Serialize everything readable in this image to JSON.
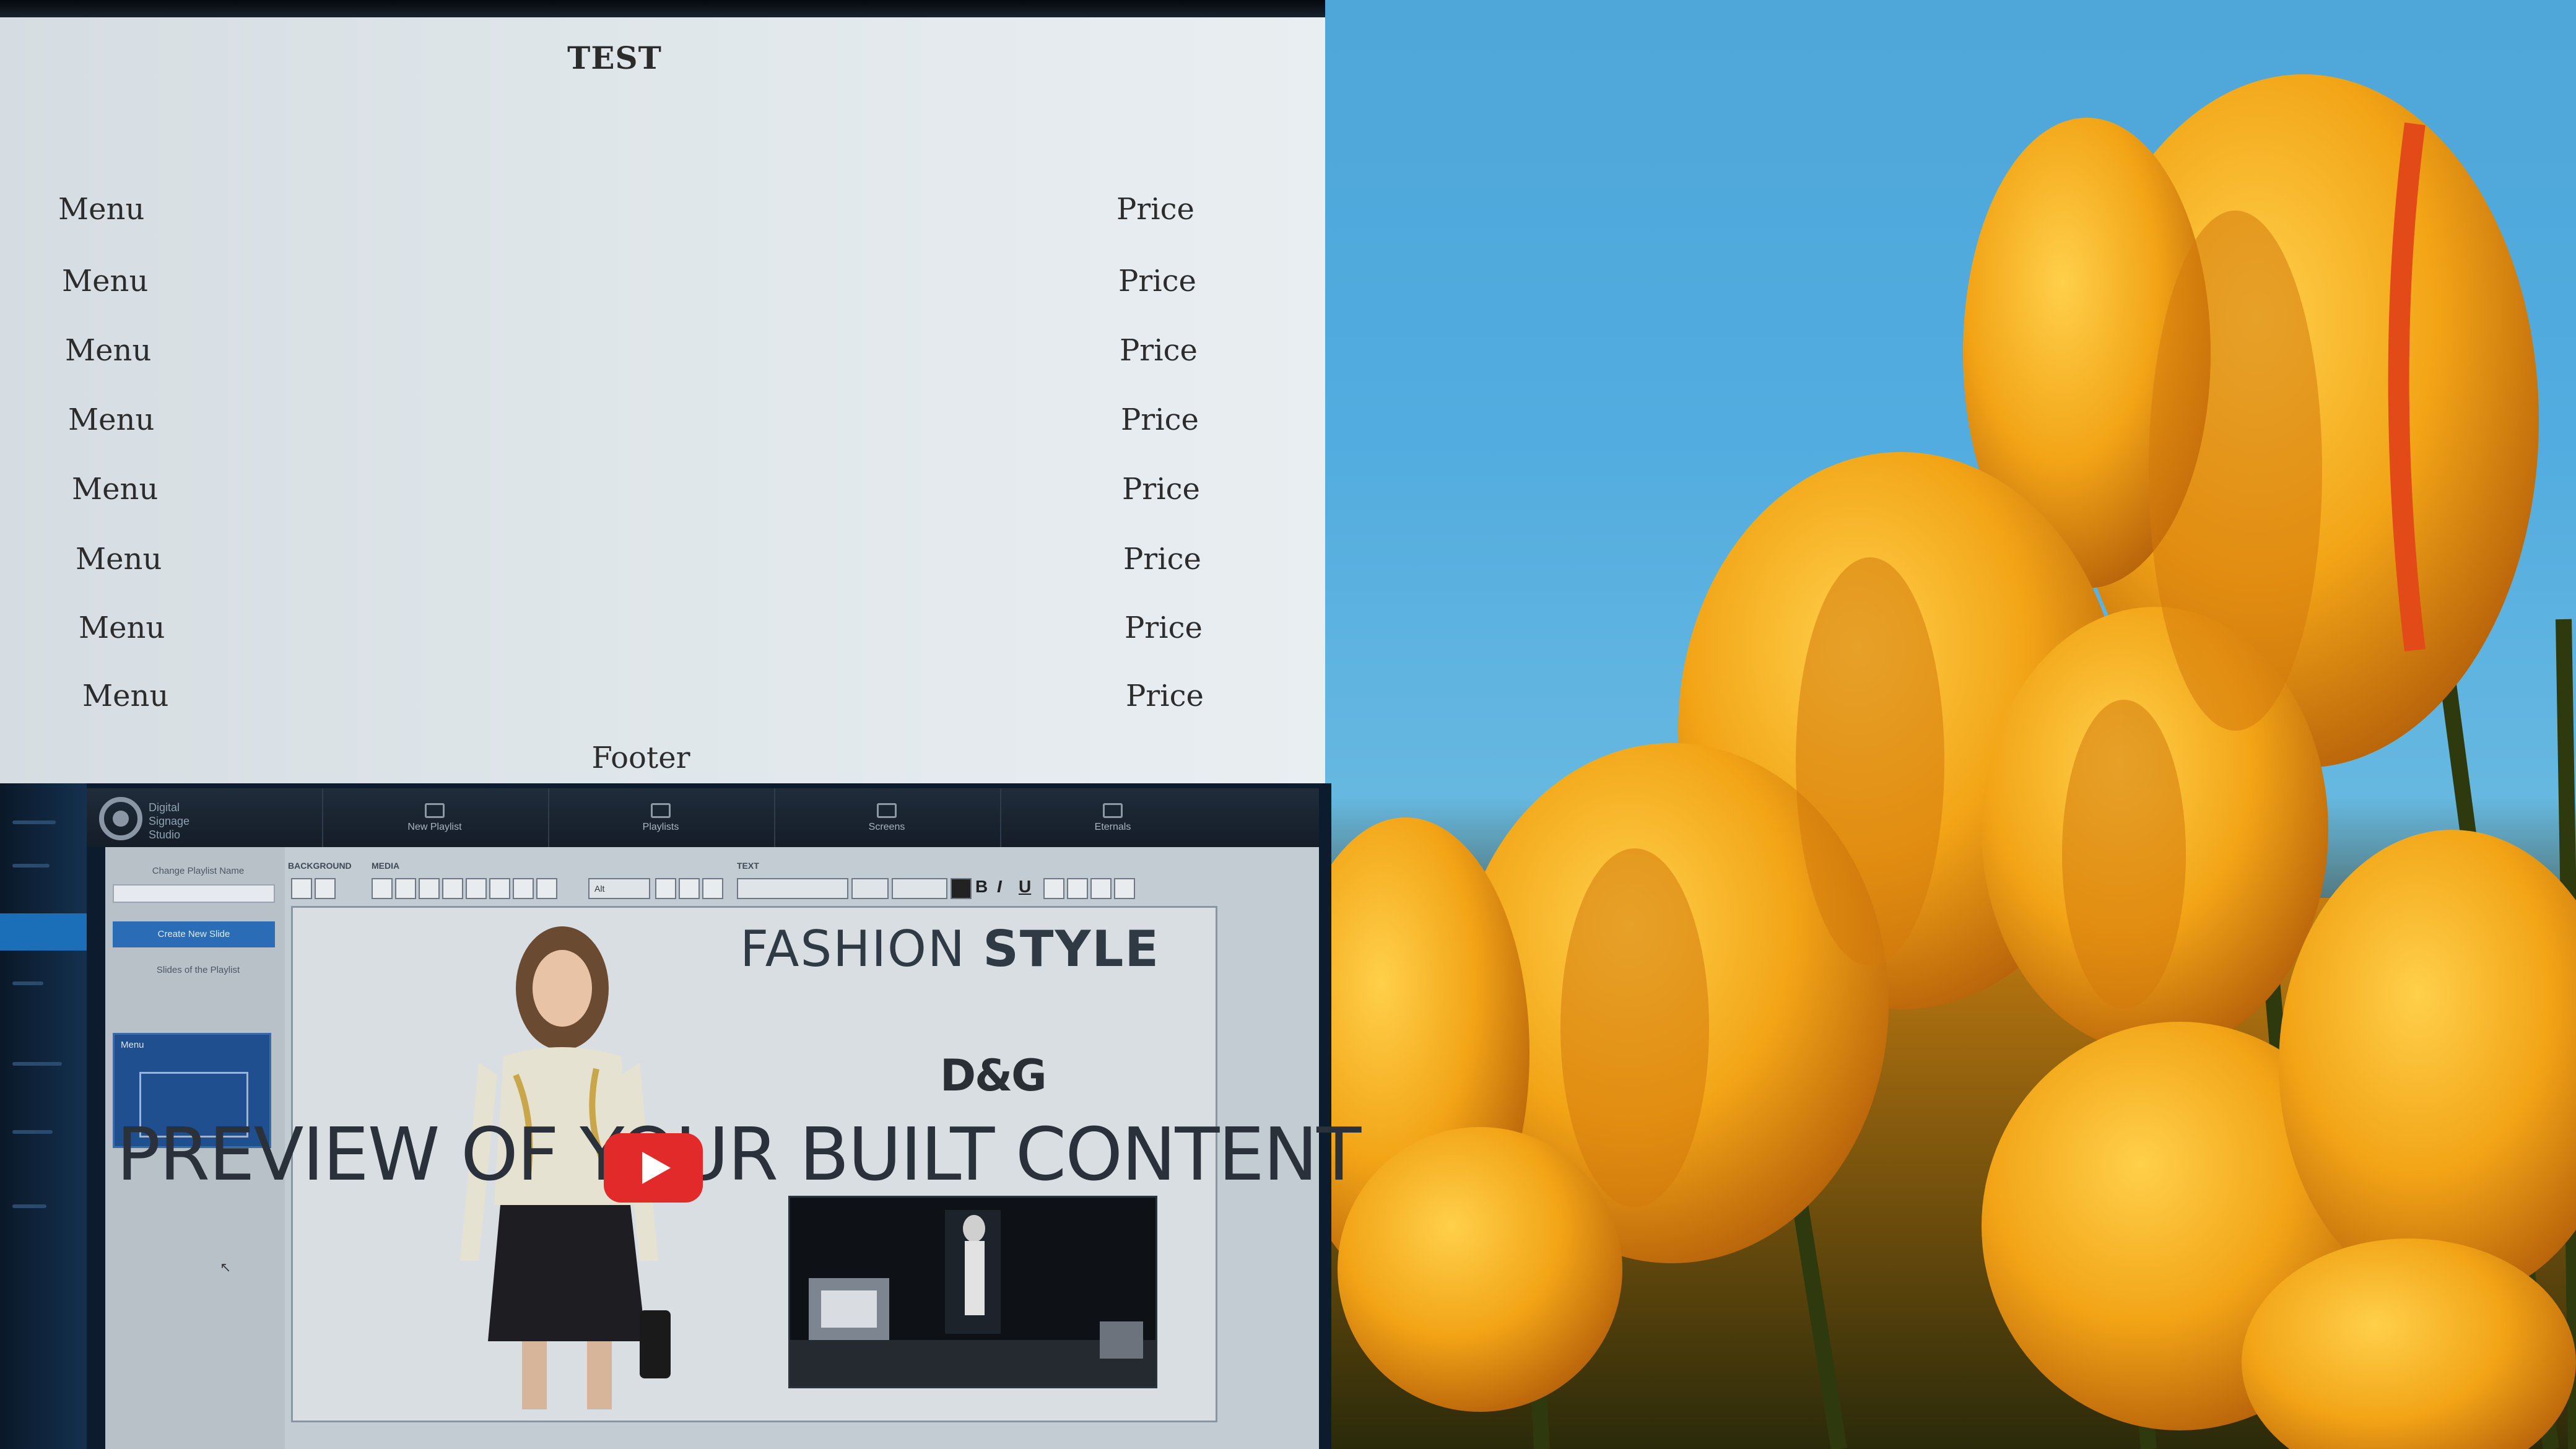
{
  "menu_board": {
    "title": "TEST",
    "items": [
      {
        "name": "Menu",
        "price": "Price"
      },
      {
        "name": "Menu",
        "price": "Price"
      },
      {
        "name": "Menu",
        "price": "Price"
      },
      {
        "name": "Menu",
        "price": "Price"
      },
      {
        "name": "Menu",
        "price": "Price"
      },
      {
        "name": "Menu",
        "price": "Price"
      },
      {
        "name": "Menu",
        "price": "Price"
      },
      {
        "name": "Menu",
        "price": "Price"
      }
    ],
    "footer": "Footer"
  },
  "cms_preview": {
    "brand": "Digital Signage Studio",
    "tabs": [
      {
        "label": "New Playlist",
        "icon": "monitor-icon"
      },
      {
        "label": "Playlists",
        "icon": "layers-icon"
      },
      {
        "label": "Screens",
        "icon": "monitor-icon"
      },
      {
        "label": "Eternals",
        "icon": "monitor-icon"
      }
    ],
    "sidepanel": {
      "name_label": "Change Playlist Name",
      "name_value": "",
      "create_button": "Create New Slide",
      "slides_label": "Slides of the Playlist",
      "slide_name": "Menu"
    },
    "toolbar": {
      "background_label": "BACKGROUND",
      "media_label": "MEDIA",
      "text_label": "TEXT",
      "align_select": "Alt",
      "format_buttons": [
        "B",
        "I",
        "U"
      ]
    },
    "canvas": {
      "headline_light": "FASHION ",
      "headline_bold": "STYLE",
      "brand": "D&G"
    },
    "overlay_caption": "PREVIEW OF YOUR BUILT CONTENT"
  },
  "colors": {
    "sky": "#52acdf",
    "tulip": "#f2a416",
    "stem": "#3b4a12",
    "play_button": "#e32a2a"
  }
}
